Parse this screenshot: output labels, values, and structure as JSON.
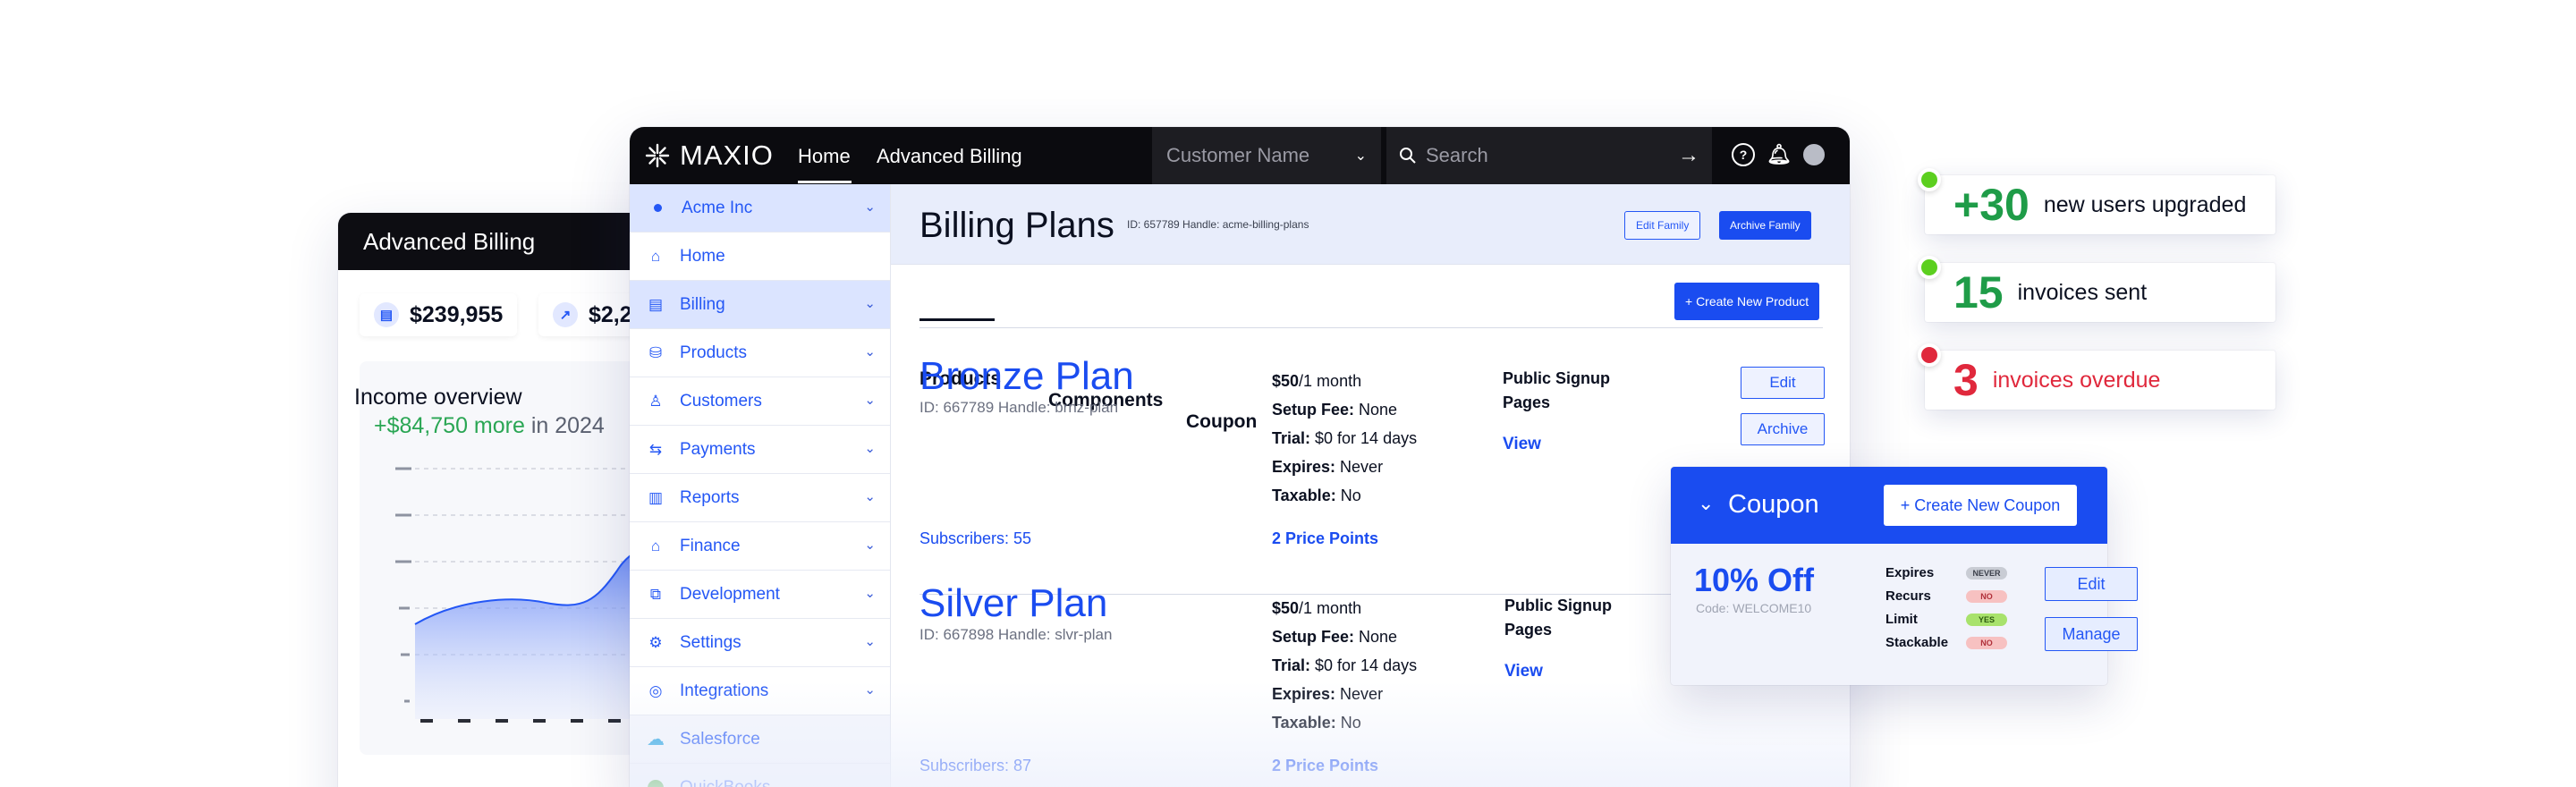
{
  "back_card": {
    "title": "Advanced Billing",
    "stat1": "$239,955",
    "stat2": "$2,2",
    "income_title": "Income overview",
    "income_change": "+$84,750 more",
    "income_suffix": " in 2024"
  },
  "topbar": {
    "logo": "MAXIO",
    "nav_home": "Home",
    "nav_advanced_billing": "Advanced Billing",
    "customer_placeholder": "Customer Name",
    "search_placeholder": "Search"
  },
  "sidebar": {
    "items": [
      {
        "label": "Acme Inc",
        "icon": "dot-icon"
      },
      {
        "label": "Home",
        "icon": "home-icon"
      },
      {
        "label": "Billing",
        "icon": "billing-icon"
      },
      {
        "label": "Products",
        "icon": "products-icon"
      },
      {
        "label": "Customers",
        "icon": "customers-icon"
      },
      {
        "label": "Payments",
        "icon": "payments-icon"
      },
      {
        "label": "Reports",
        "icon": "reports-icon"
      },
      {
        "label": "Finance",
        "icon": "finance-icon"
      },
      {
        "label": "Development",
        "icon": "development-icon"
      },
      {
        "label": "Settings",
        "icon": "settings-icon"
      },
      {
        "label": "Integrations",
        "icon": "integrations-icon"
      },
      {
        "label": "Salesforce",
        "icon": "salesforce-icon"
      },
      {
        "label": "QuickBooks",
        "icon": "quickbooks-icon"
      }
    ]
  },
  "content": {
    "title": "Billing Plans",
    "meta": "ID: 657789 Handle: acme-billing-plans",
    "edit_family": "Edit Family",
    "archive_family": "Archive Family",
    "tabs": [
      "Products",
      "Components",
      "Coupon"
    ],
    "create_product": "+ Create New Product",
    "plans": [
      {
        "name": "Bronze Plan",
        "id_line": "ID: 667789 Handle: brnz-plan",
        "subscribers": "Subscribers: 55",
        "price_bold": "$50",
        "price_rest": "/1 month",
        "setup_label": "Setup Fee:",
        "setup_value": " None",
        "trial_label": "Trial:",
        "trial_value": " $0 for 14 days",
        "expires_label": "Expires:",
        "expires_value": " Never",
        "taxable_label": "Taxable:",
        "taxable_value": " No",
        "price_points": "2 Price Points",
        "public_signup": "Public Signup Pages",
        "view": "View",
        "edit": "Edit",
        "archive": "Archive"
      },
      {
        "name": "Silver Plan",
        "id_line": "ID: 667898 Handle: slvr-plan",
        "subscribers": "Subscribers: 87",
        "price_bold": "$50",
        "price_rest": "/1 month",
        "setup_label": "Setup Fee:",
        "setup_value": " None",
        "trial_label": "Trial:",
        "trial_value": " $0 for 14 days",
        "expires_label": "Expires:",
        "expires_value": " Never",
        "taxable_label": "Taxable:",
        "taxable_value": " No",
        "price_points": "2 Price Points",
        "public_signup": "Public Signup Pages",
        "view": "View"
      }
    ]
  },
  "coupon": {
    "title": "Coupon",
    "create": "+ Create New Coupon",
    "amount": "10% Off",
    "code": "Code: WELCOME10",
    "rows": [
      {
        "label": "Expires",
        "value": "NEVER"
      },
      {
        "label": "Recurs",
        "value": "NO"
      },
      {
        "label": "Limit",
        "value": "YES"
      },
      {
        "label": "Stackable",
        "value": "NO"
      }
    ],
    "edit": "Edit",
    "manage": "Manage"
  },
  "notifications": [
    {
      "number": "+30",
      "text": "new users upgraded",
      "color": "#1f9c48",
      "bullet": "#5ccf1f"
    },
    {
      "number": "15",
      "text": "invoices sent",
      "color": "#1f9c48",
      "bullet": "#5ccf1f"
    },
    {
      "number": "3",
      "text": "invoices overdue",
      "color": "#e0283c",
      "bullet": "#e0283c"
    }
  ]
}
